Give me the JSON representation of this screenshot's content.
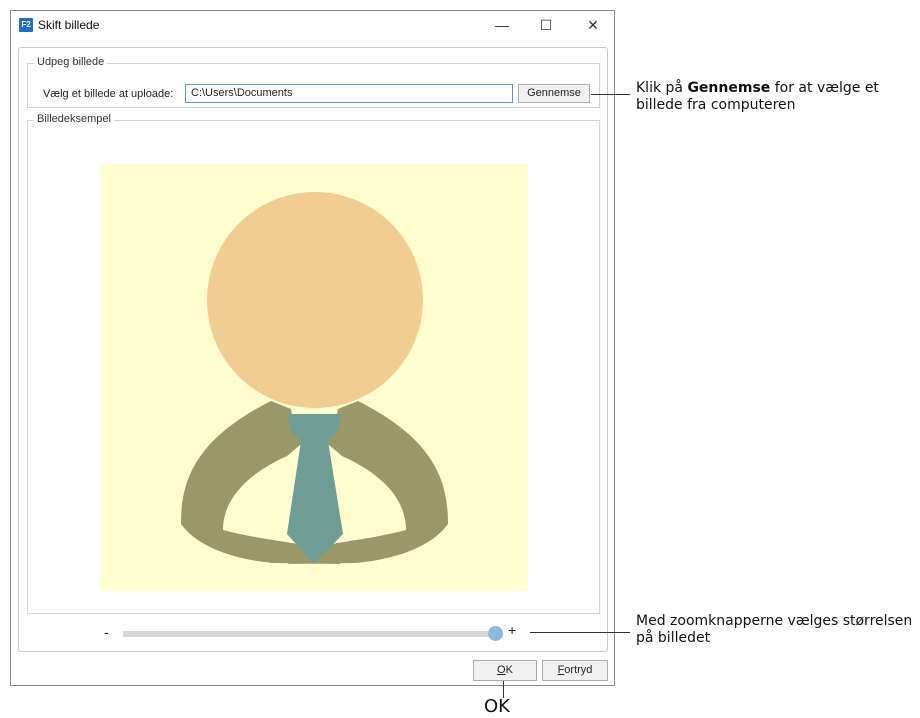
{
  "window": {
    "icon_text": "F2",
    "title": "Skift billede",
    "minimize": "—",
    "maximize": "☐",
    "close": "✕"
  },
  "select_group": {
    "label": "Udpeg billede",
    "field_label": "Vælg et billede at uploade:",
    "path_value": "C:\\Users\\Documents",
    "browse_label": "Gennemse"
  },
  "preview_group": {
    "label": "Billedeksempel",
    "image_icon": "person-avatar-icon",
    "background_color": "#fffed0",
    "head_color": "#f1cd93",
    "body_color": "#9a9868",
    "tie_color": "#6f9c95"
  },
  "zoom": {
    "minus": "-",
    "plus": "+",
    "level": 1.0
  },
  "buttons": {
    "ok_mnemonic": "O",
    "ok_rest": "K",
    "cancel_mnemonic": "F",
    "cancel_rest": "ortryd"
  },
  "callouts": {
    "browse_prefix": "Klik på ",
    "browse_bold": "Gennemse",
    "browse_suffix": " for at vælge et billede fra computeren",
    "zoom": "Med zoomknapperne vælges størrelsen på billedet",
    "ok": "OK"
  }
}
